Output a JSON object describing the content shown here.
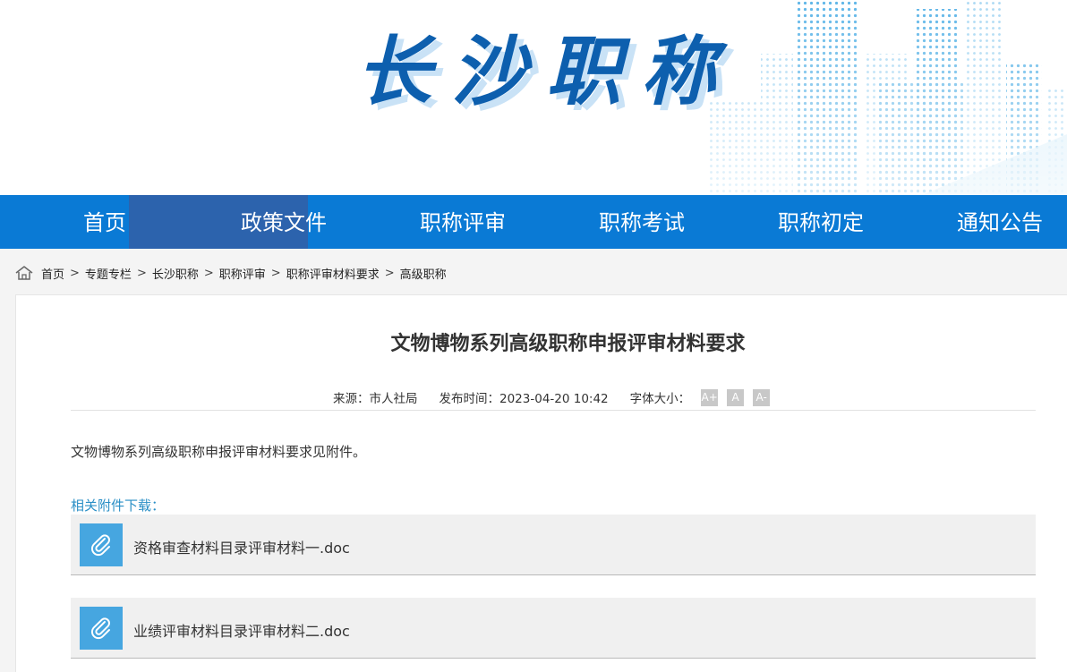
{
  "site": {
    "title": "长沙职称"
  },
  "nav": {
    "items": [
      {
        "label": "首页"
      },
      {
        "label": "政策文件"
      },
      {
        "label": "职称评审"
      },
      {
        "label": "职称考试"
      },
      {
        "label": "职称初定"
      },
      {
        "label": "通知公告"
      }
    ],
    "active_index": 1
  },
  "breadcrumb": {
    "items": [
      "首页",
      "专题专栏",
      "长沙职称",
      "职称评审",
      "职称评审材料要求",
      "高级职称"
    ],
    "separator": ">"
  },
  "article": {
    "title": "文物博物系列高级职称申报评审材料要求",
    "source_label": "来源：市人社局",
    "publish_label": "发布时间：2023-04-20 10:42",
    "font_size_label": "字体大小：",
    "font_size_buttons": [
      "A+",
      "A",
      "A-"
    ],
    "body": "文物博物系列高级职称申报评审材料要求见附件。",
    "attachments_heading": "相关附件下载：",
    "attachments": [
      {
        "name": "资格审查材料目录评审材料一.doc"
      },
      {
        "name": "业绩评审材料目录评审材料二.doc"
      }
    ]
  },
  "colors": {
    "nav_bg": "#0a7ad5",
    "nav_active_bg": "#2c63ad",
    "title_blue": "#0d5fae",
    "attachment_heading": "#2a8fc6",
    "attachment_icon_bg": "#46a6e0"
  },
  "icons": {
    "breadcrumb_home": "home-icon",
    "attachment": "paperclip-icon"
  }
}
